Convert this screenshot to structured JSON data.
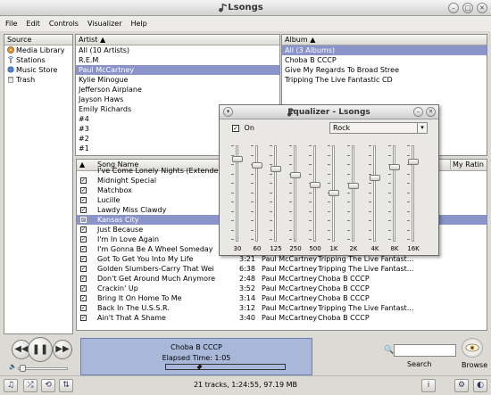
{
  "window": {
    "title": "Lsongs"
  },
  "menu": [
    "File",
    "Edit",
    "Controls",
    "Visualizer",
    "Help"
  ],
  "source": {
    "header": "Source",
    "items": [
      {
        "label": "Media Library",
        "icon": "media-library-icon"
      },
      {
        "label": "Stations",
        "icon": "stations-icon"
      },
      {
        "label": "Music Store",
        "icon": "music-store-icon"
      },
      {
        "label": "Trash",
        "icon": "trash-icon"
      }
    ]
  },
  "artists": {
    "header": "Artist",
    "items": [
      "All (10 Artists)",
      "R.E.M",
      "Paul McCartney",
      "Kylie Minogue",
      "Jefferson Airplane",
      "Jayson Haws",
      "Emily Richards",
      "#4",
      "#3",
      "#2",
      "#1"
    ],
    "selected_index": 2
  },
  "albums": {
    "header": "Album",
    "items": [
      "All (3 Albums)",
      "Choba B CCCP",
      "Give My Regards To Broad Stree",
      "Tripping The Live Fantastic CD"
    ],
    "selected_index": 0
  },
  "songs": {
    "col_name": "Song Name",
    "col_rating": "My Ratin",
    "partial_top": "I've Come Lonely Nights (Extende",
    "rows": [
      {
        "name": "Midnight Special",
        "time": "",
        "artist": "",
        "album": ""
      },
      {
        "name": "Matchbox",
        "time": "",
        "artist": "",
        "album": ""
      },
      {
        "name": "Lucille",
        "time": "",
        "artist": "",
        "album": ""
      },
      {
        "name": "Lawdy Miss Clawdy",
        "time": "",
        "artist": "",
        "album": ""
      },
      {
        "name": "Kansas City",
        "time": "",
        "artist": "",
        "album": "",
        "selected": true
      },
      {
        "name": "Just Because",
        "time": "",
        "artist": "",
        "album": ""
      },
      {
        "name": "I'm In Love Again",
        "time": "",
        "artist": "",
        "album": ""
      },
      {
        "name": "I'm Gonna Be A Wheel Someday",
        "time": "",
        "artist": "",
        "album": ""
      },
      {
        "name": "Got To Get You Into My Life",
        "time": "3:21",
        "artist": "Paul McCartney",
        "album": "Tripping The Live Fantast..."
      },
      {
        "name": "Golden Slumbers-Carry That Wei",
        "time": "6:38",
        "artist": "Paul McCartney",
        "album": "Tripping The Live Fantast..."
      },
      {
        "name": "Don't Get Around Much Anymore",
        "time": "2:48",
        "artist": "Paul McCartney",
        "album": "Choba B CCCP"
      },
      {
        "name": "Crackin' Up",
        "time": "3:52",
        "artist": "Paul McCartney",
        "album": "Choba B CCCP"
      },
      {
        "name": "Bring It On Home To Me",
        "time": "3:14",
        "artist": "Paul McCartney",
        "album": "Choba B CCCP"
      },
      {
        "name": "Back In The U.S.S.R.",
        "time": "3:12",
        "artist": "Paul McCartney",
        "album": "Tripping The Live Fantast..."
      },
      {
        "name": "Ain't That A Shame",
        "time": "3:40",
        "artist": "Paul McCartney",
        "album": "Choba B CCCP"
      }
    ]
  },
  "now_playing": {
    "album": "Choba B CCCP",
    "elapsed": "Elapsed Time: 1:05",
    "progress": 0.27
  },
  "search": {
    "label": "Search",
    "value": ""
  },
  "browse": {
    "label": "Browse"
  },
  "status": {
    "text": "21 tracks, 1:24:55, 97.19 MB"
  },
  "equalizer": {
    "title": "Equalizer - Lsongs",
    "on_label": "On",
    "on_checked": true,
    "preset": "Rock",
    "bands": [
      {
        "label": "30",
        "level": 0.35
      },
      {
        "label": "60",
        "level": 0.28
      },
      {
        "label": "125",
        "level": 0.24
      },
      {
        "label": "250",
        "level": 0.17
      },
      {
        "label": "500",
        "level": 0.06
      },
      {
        "label": "1K",
        "level": -0.03
      },
      {
        "label": "2K",
        "level": 0.05
      },
      {
        "label": "4K",
        "level": 0.14
      },
      {
        "label": "8K",
        "level": 0.26
      },
      {
        "label": "16K",
        "level": 0.32
      }
    ]
  },
  "colors": {
    "selection": "#8a94c8",
    "info_panel": "#a9b7d8"
  }
}
